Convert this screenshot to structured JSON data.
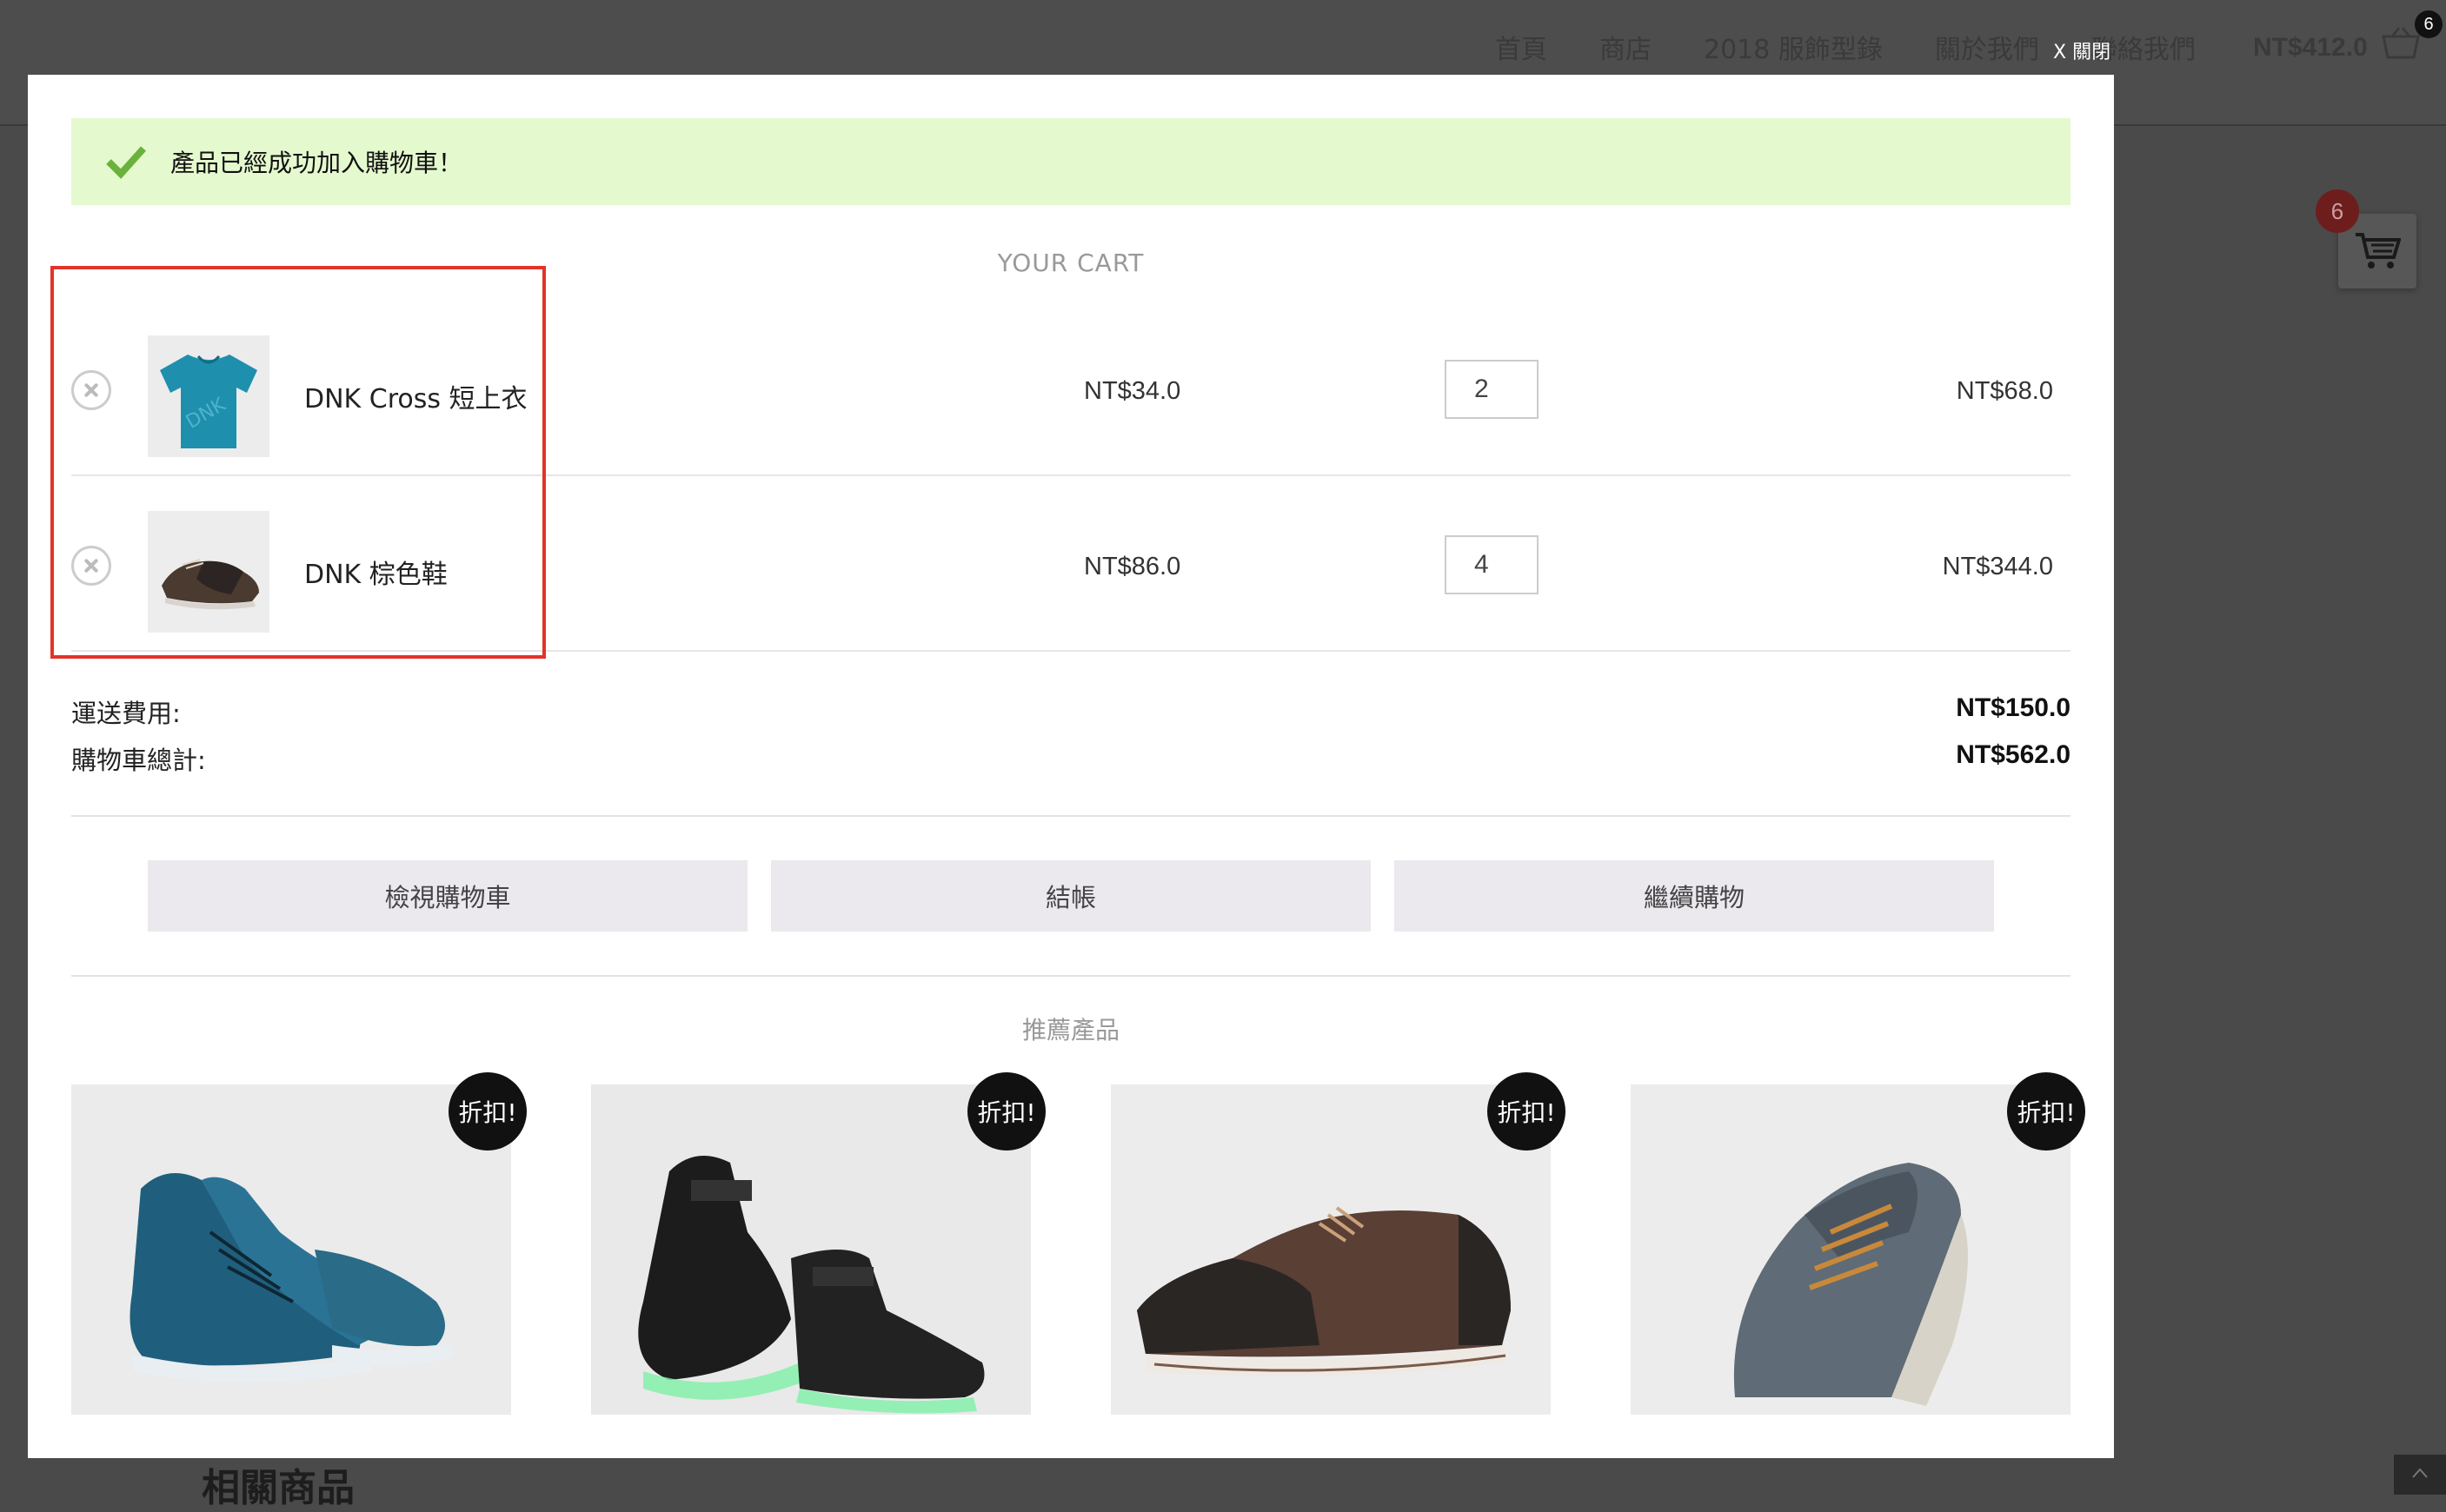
{
  "background": {
    "nav": [
      "首頁",
      "商店",
      "2018 服飾型錄",
      "關於我們",
      "聯絡我們"
    ],
    "header_total": "NT$412.0",
    "header_cart_count": "6",
    "floating_cart_count": "6",
    "related_heading": "相關商品"
  },
  "modal": {
    "close_label": "X 關閉",
    "success_message": "產品已經成功加入購物車！",
    "cart_title": "YOUR CART",
    "items": [
      {
        "name": "DNK Cross 短上衣",
        "unit_price": "NT$34.0",
        "quantity": "2",
        "line_total": "NT$68.0",
        "image": "blue-tshirt"
      },
      {
        "name": "DNK 棕色鞋",
        "unit_price": "NT$86.0",
        "quantity": "4",
        "line_total": "NT$344.0",
        "image": "brown-shoe"
      }
    ],
    "shipping_label": "運送費用:",
    "shipping_value": "NT$150.0",
    "total_label": "購物車總計:",
    "total_value": "NT$562.0",
    "buttons": {
      "view_cart": "檢視購物車",
      "checkout": "結帳",
      "continue": "繼續購物"
    },
    "recommended_title": "推薦產品",
    "recommended": [
      {
        "badge": "折扣!",
        "image": "blue-high-top-sneaker"
      },
      {
        "badge": "折扣!",
        "image": "black-led-sneaker"
      },
      {
        "badge": "折扣!",
        "image": "brown-leather-shoe"
      },
      {
        "badge": "折扣!",
        "image": "grey-felt-shoe"
      }
    ]
  },
  "colors": {
    "success_bg": "#e5f9cf",
    "check_green": "#6ab23c",
    "highlight_red": "#e2342a",
    "button_bg": "#ebe8ee"
  }
}
